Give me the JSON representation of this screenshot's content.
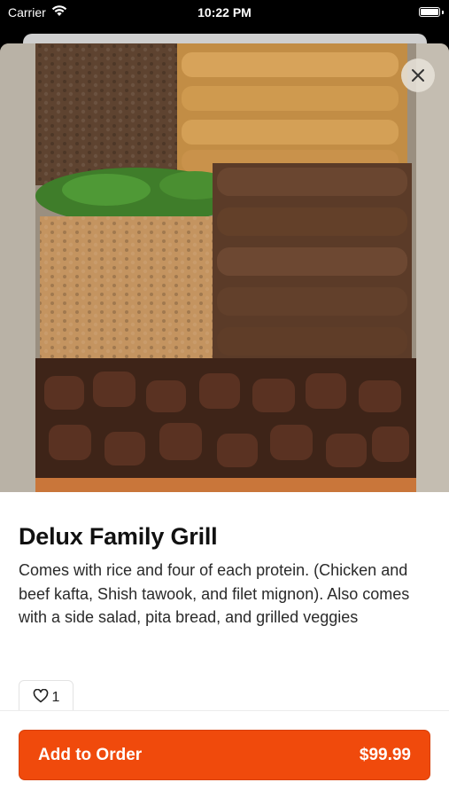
{
  "status_bar": {
    "carrier": "Carrier",
    "time": "10:22 PM"
  },
  "item": {
    "title": "Delux Family Grill",
    "description": "Comes with rice and four of each protein. (Chicken and beef kafta, Shish tawook, and filet mignon). Also comes with a side salad, pita bread, and grilled veggies",
    "like_count": "1"
  },
  "order": {
    "add_label": "Add to Order",
    "price": "$99.99"
  },
  "icons": {
    "wifi": "wifi-icon",
    "battery": "battery-icon",
    "close": "close-icon",
    "heart": "heart-icon"
  },
  "colors": {
    "accent": "#f04a0c",
    "text": "#111111",
    "status_bar_bg": "#000000"
  }
}
